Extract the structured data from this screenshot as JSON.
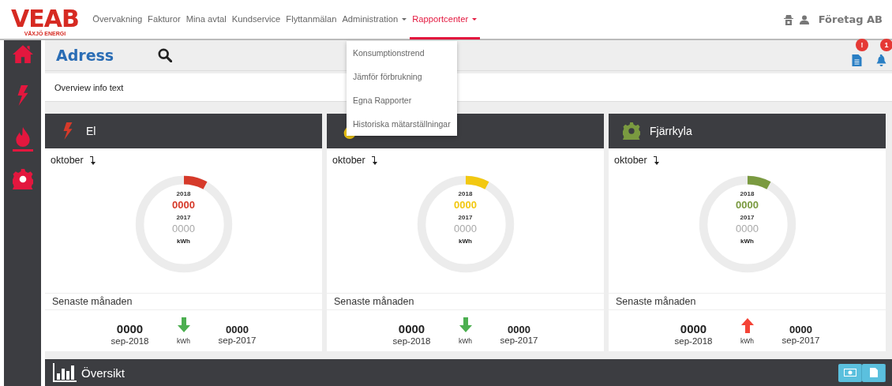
{
  "logo": {
    "name": "VEAB",
    "tagline": "VÄXJÖ ENERGI"
  },
  "nav": [
    {
      "label": "Övervakning",
      "selected": false,
      "dropdown": false
    },
    {
      "label": "Fakturor",
      "selected": false,
      "dropdown": false
    },
    {
      "label": "Mina avtal",
      "selected": false,
      "dropdown": false
    },
    {
      "label": "Kundservice",
      "selected": false,
      "dropdown": false
    },
    {
      "label": "Flyttanmälan",
      "selected": false,
      "dropdown": false
    },
    {
      "label": "Administration",
      "selected": false,
      "dropdown": true
    },
    {
      "label": "Rapportcenter",
      "selected": true,
      "dropdown": true
    }
  ],
  "dropdown_menu": [
    "Konsumptionstrend",
    "Jämför förbrukning",
    "Egna Rapporter",
    "Historiska mätarställningar"
  ],
  "user": {
    "company": "Företag AB"
  },
  "sidebar": {
    "items": [
      {
        "kind": "home",
        "selected": false
      },
      {
        "kind": "electricity",
        "selected": false
      },
      {
        "kind": "heating",
        "selected": true
      },
      {
        "kind": "settings",
        "selected": false
      }
    ]
  },
  "page": {
    "title": "Adress",
    "info": "Overview info text",
    "notifications": [
      {
        "kind": "document",
        "badge": "!"
      },
      {
        "kind": "bell",
        "badge": "1"
      }
    ]
  },
  "cards": [
    {
      "kind": "electricity",
      "title": "El",
      "color": "#d63a2a",
      "month": "oktober",
      "level": 0.08,
      "year_current": "2018",
      "value_current": "0000",
      "year_previous": "2017",
      "value_previous": "0000",
      "unit": "kWh",
      "period_label": "Senaste månaden",
      "latest_value": "0000",
      "latest_period": "sep-2018",
      "trend": {
        "kind": "down",
        "unit": "kWh"
      },
      "previous_value": "0000",
      "previous_period": "sep-2017"
    },
    {
      "kind": "heating",
      "color": "#f2c811",
      "month": "oktober",
      "level": 0.08,
      "year_current": "2018",
      "value_current": "0000",
      "year_previous": "2017",
      "value_previous": "0000",
      "unit": "kWh",
      "period_label": "Senaste månaden",
      "latest_value": "0000",
      "latest_period": "sep-2018",
      "trend": {
        "kind": "down",
        "unit": "kWh"
      },
      "previous_value": "0000",
      "previous_period": "sep-2017"
    },
    {
      "kind": "cooling",
      "title": "Fjärrkyla",
      "color": "#7a9a40",
      "month": "oktober",
      "level": 0.08,
      "year_current": "2018",
      "value_current": "0000",
      "year_previous": "2017",
      "value_previous": "0000",
      "unit": "kWh",
      "period_label": "Senaste månaden",
      "latest_value": "0000",
      "latest_period": "sep-2018",
      "trend": {
        "kind": "up",
        "unit": "kWh"
      },
      "previous_value": "0000",
      "previous_period": "sep-2017"
    }
  ],
  "overview": {
    "title": "Översikt"
  }
}
